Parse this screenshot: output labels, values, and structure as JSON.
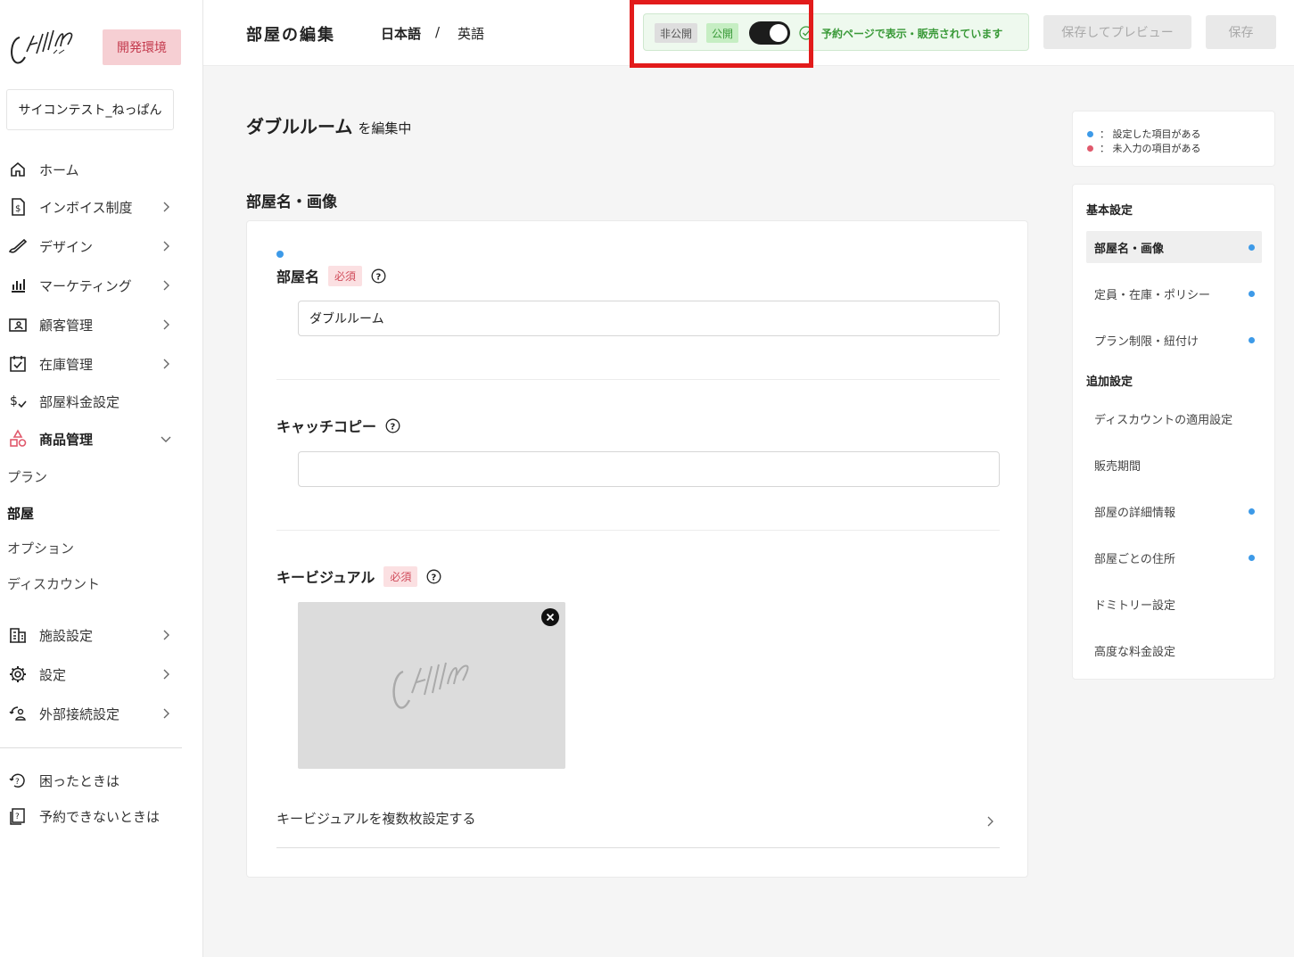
{
  "sidebar": {
    "env_badge": "開発環境",
    "facility_name": "サイコンテスト_ねっぱん",
    "nav": [
      {
        "label": "ホーム"
      },
      {
        "label": "インボイス制度"
      },
      {
        "label": "デザイン"
      },
      {
        "label": "マーケティング"
      },
      {
        "label": "顧客管理"
      },
      {
        "label": "在庫管理"
      },
      {
        "label": "部屋料金設定"
      },
      {
        "label": "商品管理"
      }
    ],
    "sub_items": [
      "プラン",
      "部屋",
      "オプション",
      "ディスカウント"
    ],
    "nav2": [
      {
        "label": "施設設定"
      },
      {
        "label": "設定"
      },
      {
        "label": "外部接続設定"
      }
    ],
    "help": [
      {
        "label": "困ったときは"
      },
      {
        "label": "予約できないときは"
      }
    ]
  },
  "header": {
    "title": "部屋の編集",
    "lang_ja": "日本語",
    "lang_sep": "/",
    "lang_en": "英語",
    "status_private": "非公開",
    "status_public": "公開",
    "status_message": "予約ページで表示・販売されています",
    "preview_button": "保存してプレビュー",
    "save_button": "保存",
    "colors": {
      "status_green": "#3a9a39",
      "highlight_red": "#e21b1b"
    }
  },
  "main": {
    "room_name": "ダブルルーム",
    "editing_suffix": "を編集中",
    "section_title": "部屋名・画像",
    "fields": {
      "room_name_label": "部屋名",
      "required": "必須",
      "room_name_value": "ダブルルーム",
      "catch_label": "キャッチコピー",
      "catch_value": "",
      "visual_label": "キービジュアル",
      "multi_visual": "キービジュアルを複数枚設定する"
    }
  },
  "legend": {
    "set": "： 設定した項目がある",
    "missing": "： 未入力の項目がある",
    "colors": {
      "set": "#3d9ae8",
      "missing": "#e0596c"
    }
  },
  "right_panel": {
    "basic_group": "基本設定",
    "basic_items": [
      {
        "label": "部屋名・画像"
      },
      {
        "label": "定員・在庫・ポリシー"
      },
      {
        "label": "プラン制限・紐付け"
      }
    ],
    "extra_group": "追加設定",
    "extra_items": [
      {
        "label": "ディスカウントの適用設定"
      },
      {
        "label": "販売期間"
      },
      {
        "label": "部屋の詳細情報"
      },
      {
        "label": "部屋ごとの住所"
      },
      {
        "label": "ドミトリー設定"
      },
      {
        "label": "高度な料金設定"
      }
    ]
  }
}
